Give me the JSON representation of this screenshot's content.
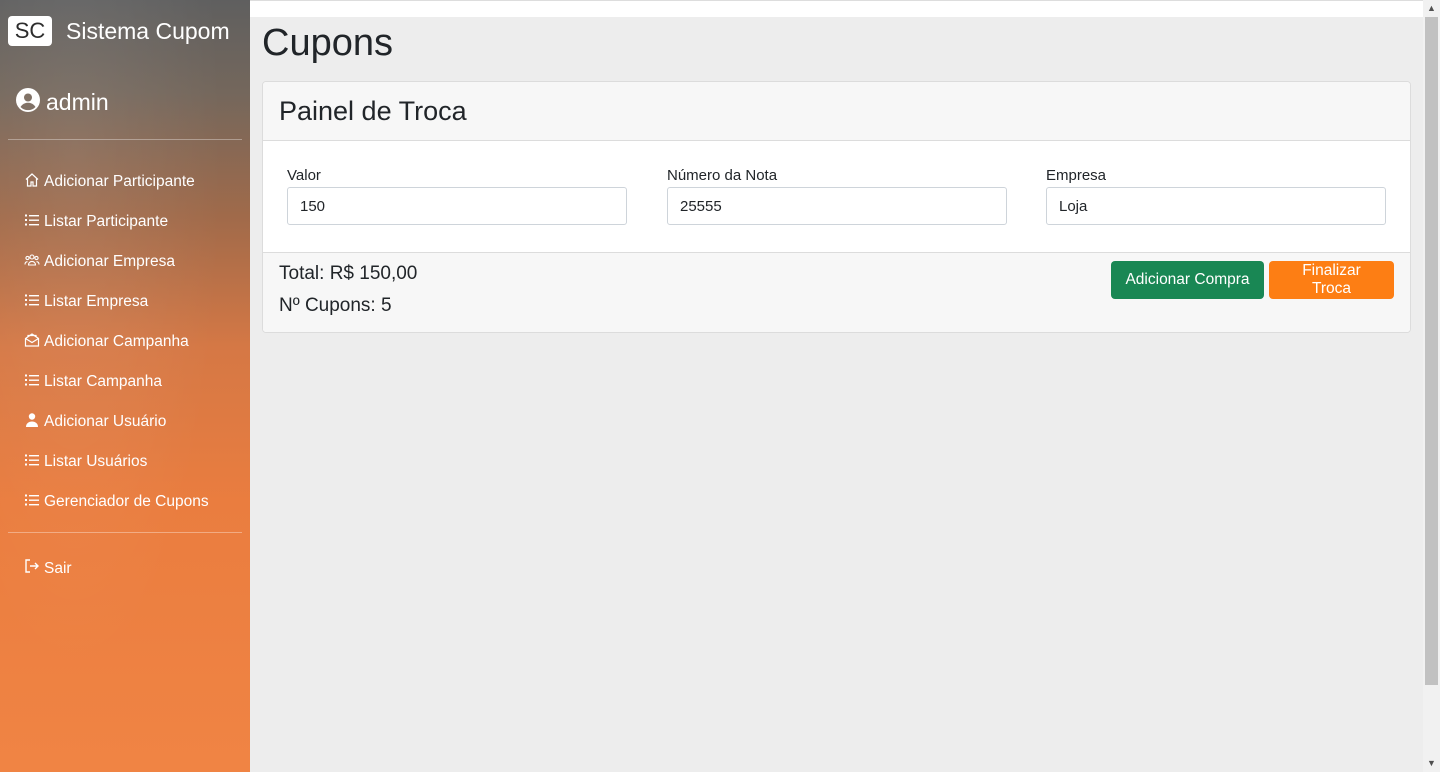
{
  "brand": {
    "logo": "SC",
    "name": "Sistema Cupom"
  },
  "user": {
    "name": "admin",
    "icon": "user-circle-icon"
  },
  "nav": [
    {
      "label": "Adicionar Participante",
      "icon": "home-icon"
    },
    {
      "label": "Listar Participante",
      "icon": "list-icon"
    },
    {
      "label": "Adicionar Empresa",
      "icon": "people-icon"
    },
    {
      "label": "Listar Empresa",
      "icon": "list-icon"
    },
    {
      "label": "Adicionar Campanha",
      "icon": "envelope-open-icon"
    },
    {
      "label": "Listar Campanha",
      "icon": "list-icon"
    },
    {
      "label": "Adicionar Usuário",
      "icon": "person-icon"
    },
    {
      "label": "Listar Usuários",
      "icon": "list-icon"
    },
    {
      "label": "Gerenciador de Cupons",
      "icon": "list-icon"
    }
  ],
  "logout": {
    "label": "Sair",
    "icon": "logout-icon"
  },
  "page": {
    "title": "Cupons"
  },
  "panel": {
    "title": "Painel de Troca",
    "fields": {
      "valor": {
        "label": "Valor",
        "value": "150"
      },
      "nota": {
        "label": "Número da Nota",
        "value": "25555"
      },
      "empresa": {
        "label": "Empresa",
        "value": "Loja"
      }
    },
    "total": "Total: R$ 150,00",
    "cupons": "Nº Cupons: 5",
    "add_button": "Adicionar Compra",
    "finish_button": "Finalizar Troca"
  },
  "colors": {
    "green": "#198754",
    "orange": "#fd7e14",
    "sidebar_bottom": "#f08444"
  }
}
